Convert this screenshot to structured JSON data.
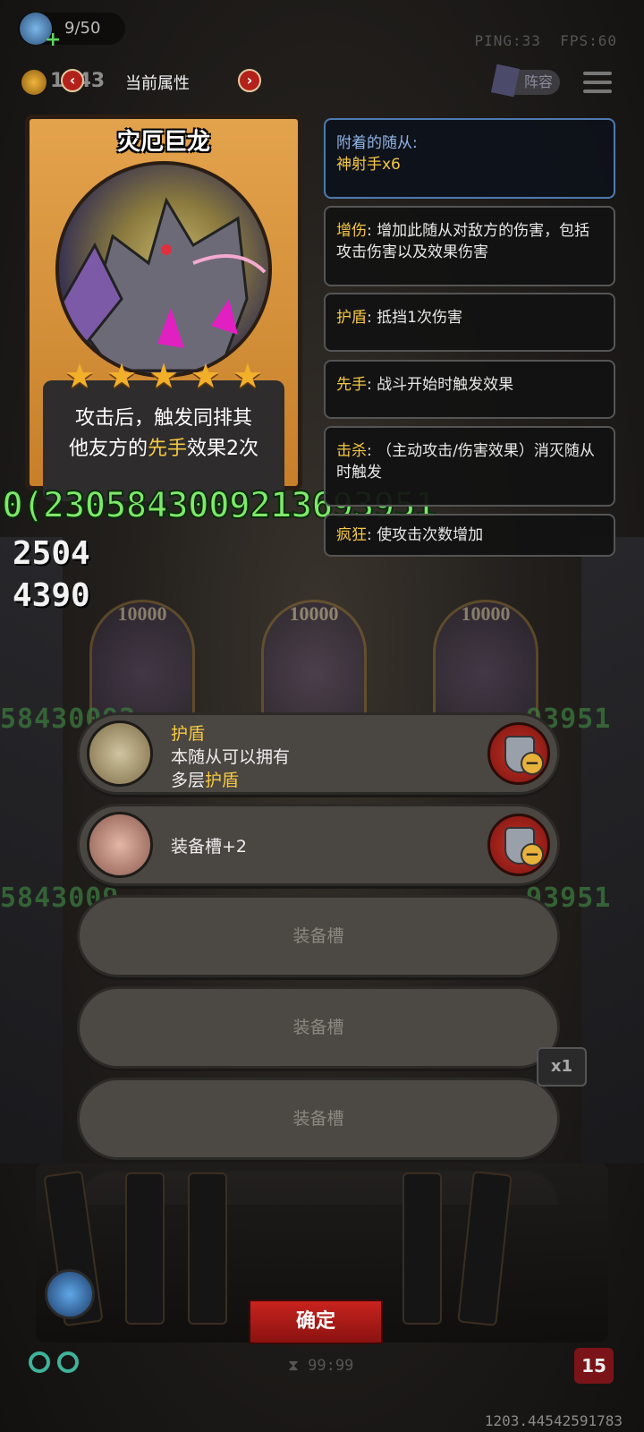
{
  "topbar": {
    "energy": "9/50",
    "ping": "PING:33",
    "fps": "FPS:60",
    "gold": "1843",
    "title": "当前属性",
    "prev_icon": "chevron-left-icon",
    "next_icon": "chevron-right-icon",
    "lineup_label": "阵容"
  },
  "hero": {
    "name": "灾厄巨龙",
    "stars": 5,
    "desc_line1": "攻击后，触发同排其",
    "desc_line2_a": "他友方的",
    "desc_line2_kw": "先手",
    "desc_line2_b": "效果2次"
  },
  "overlay": {
    "big_number": "0(2305843009213693951",
    "stat_attack": "2504",
    "stat_health": "4390"
  },
  "info": {
    "attached_key": "附着的随从:",
    "attached_value": "神射手x6",
    "boost_kw": "增伤",
    "boost_text": ": 增加此随从对敌方的伤害，包括攻击伤害以及效果伤害",
    "shield_kw": "护盾",
    "shield_text": ": 抵挡1次伤害",
    "first_kw": "先手",
    "first_text": ": 战斗开始时触发效果",
    "kill_kw": "击杀",
    "kill_text": ": （主动攻击/伤害效果）消灭随从时触发",
    "frenzy_kw": "疯狂",
    "frenzy_text": ": 使攻击次数增加"
  },
  "background": {
    "ghost_hp": "10000",
    "stream_1": "58430092",
    "stream_2": "3693951",
    "stream_3": "5843009",
    "stream_4": "93951",
    "speed": "x1"
  },
  "slots": [
    {
      "title_kw": "护盾",
      "line1": "本随从可以拥有",
      "line2_a": "多层",
      "line2_kw": "护盾",
      "icon": "mirror-icon"
    },
    {
      "title": "装备槽+2",
      "icon": "armor-icon"
    },
    {
      "empty_label": "装备槽"
    },
    {
      "empty_label": "装备槽"
    },
    {
      "empty_label": "装备槽"
    }
  ],
  "bottom": {
    "confirm": "确定",
    "timer": "99:99",
    "level": "15",
    "footer_id": "1203.44542591783"
  }
}
